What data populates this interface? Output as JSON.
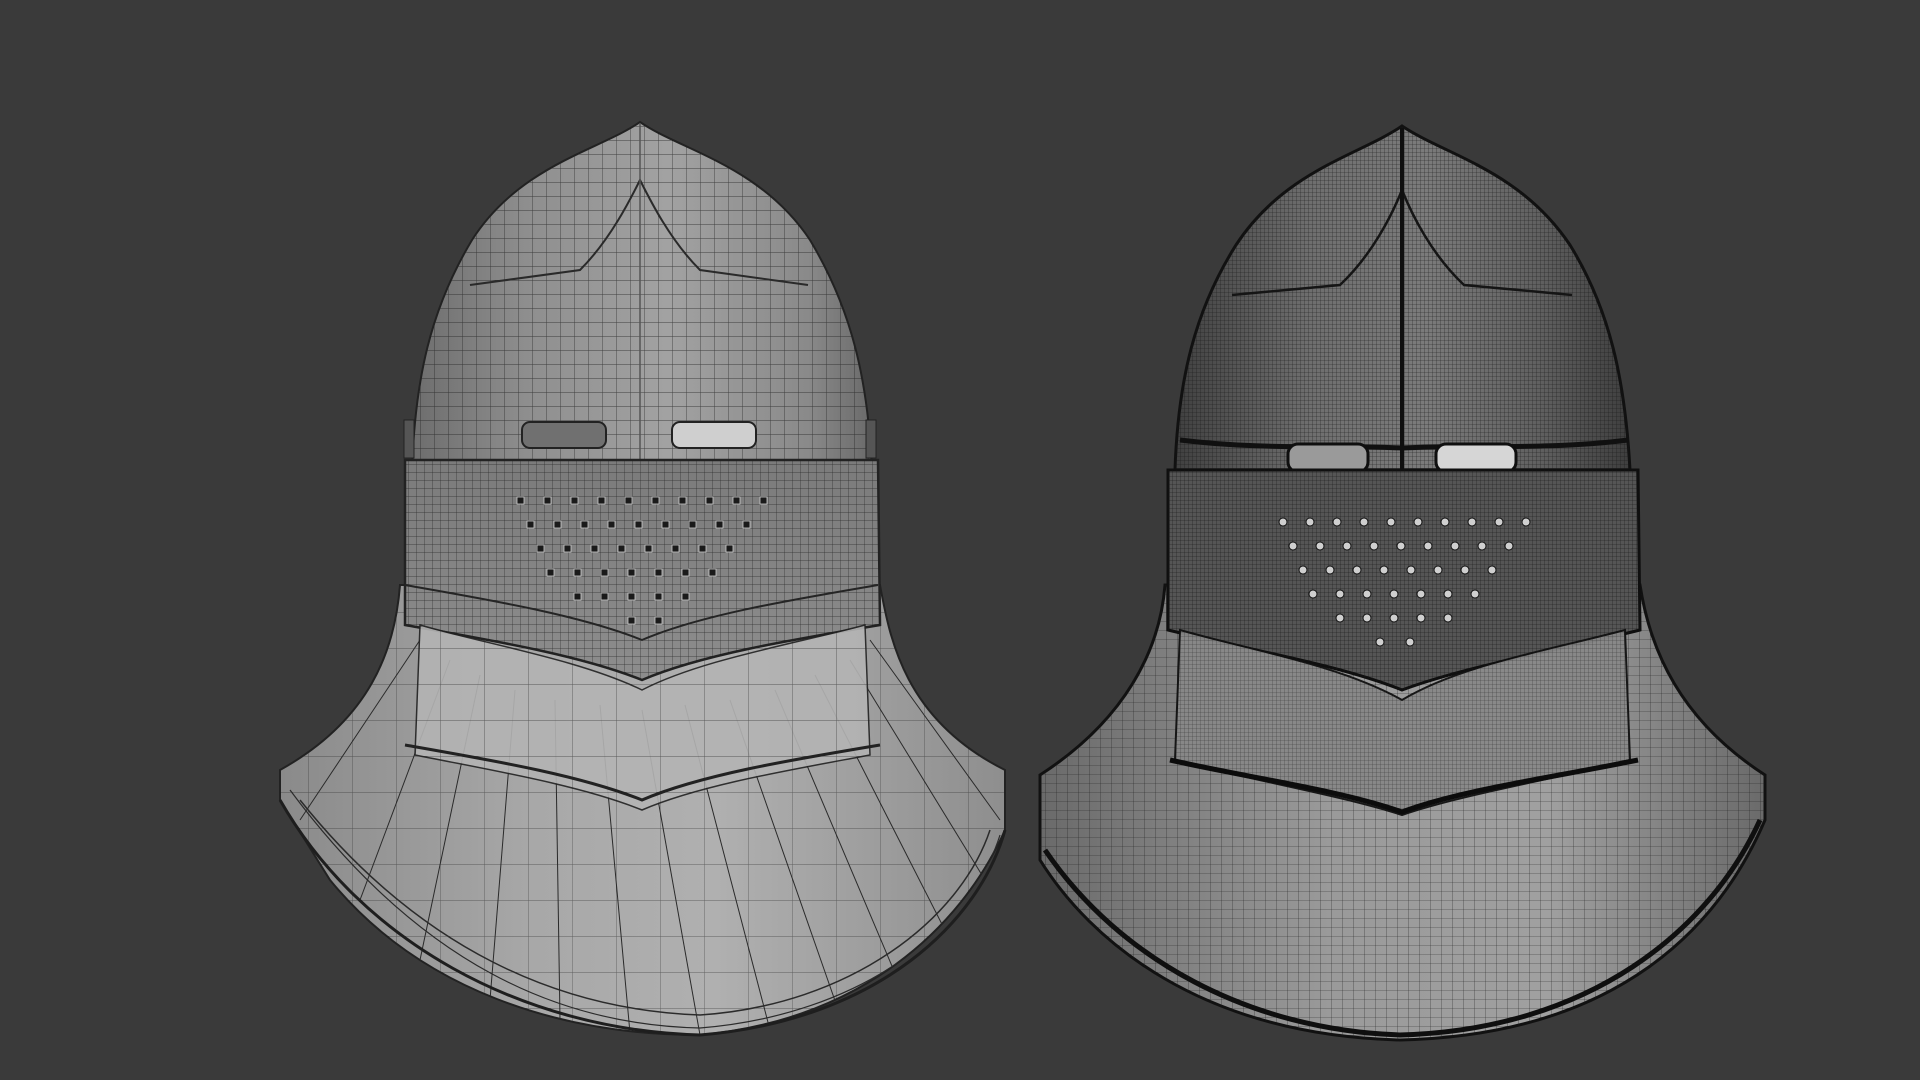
{
  "viewport": {
    "background": "#3a3a3a",
    "wire_color": "#1c1c1c",
    "surface_color": "#9a9a9a"
  },
  "models": [
    {
      "id": "helmet-lowpoly",
      "wire_density": "low"
    },
    {
      "id": "helmet-highpoly",
      "wire_density": "high"
    }
  ]
}
